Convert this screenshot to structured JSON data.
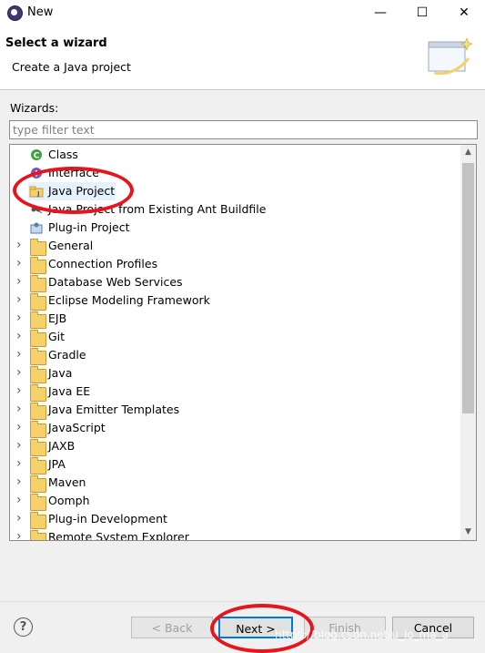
{
  "window": {
    "title": "New",
    "minimize": "—",
    "maximize": "☐",
    "close": "✕"
  },
  "header": {
    "title": "Select a wizard",
    "description": "Create a Java project"
  },
  "wizards_label": "Wizards:",
  "filter": {
    "placeholder": "type filter text",
    "value": ""
  },
  "tree_items": [
    {
      "label": "Class",
      "icon": "class-icon",
      "expandable": false
    },
    {
      "label": "Interface",
      "icon": "interface-icon",
      "expandable": false
    },
    {
      "label": "Java Project",
      "icon": "java-project-icon",
      "expandable": false,
      "selected": true
    },
    {
      "label": "Java Project from Existing Ant Buildfile",
      "icon": "ant-project-icon",
      "expandable": false
    },
    {
      "label": "Plug-in Project",
      "icon": "plugin-project-icon",
      "expandable": false
    },
    {
      "label": "General",
      "icon": "folder-icon",
      "expandable": true
    },
    {
      "label": "Connection Profiles",
      "icon": "folder-icon",
      "expandable": true
    },
    {
      "label": "Database Web Services",
      "icon": "folder-icon",
      "expandable": true
    },
    {
      "label": "Eclipse Modeling Framework",
      "icon": "folder-icon",
      "expandable": true
    },
    {
      "label": "EJB",
      "icon": "folder-icon",
      "expandable": true
    },
    {
      "label": "Git",
      "icon": "folder-icon",
      "expandable": true
    },
    {
      "label": "Gradle",
      "icon": "folder-icon",
      "expandable": true
    },
    {
      "label": "Java",
      "icon": "folder-icon",
      "expandable": true
    },
    {
      "label": "Java EE",
      "icon": "folder-icon",
      "expandable": true
    },
    {
      "label": "Java Emitter Templates",
      "icon": "folder-icon",
      "expandable": true
    },
    {
      "label": "JavaScript",
      "icon": "folder-icon",
      "expandable": true
    },
    {
      "label": "JAXB",
      "icon": "folder-icon",
      "expandable": true
    },
    {
      "label": "JPA",
      "icon": "folder-icon",
      "expandable": true
    },
    {
      "label": "Maven",
      "icon": "folder-icon",
      "expandable": true
    },
    {
      "label": "Oomph",
      "icon": "folder-icon",
      "expandable": true
    },
    {
      "label": "Plug-in Development",
      "icon": "folder-icon",
      "expandable": true
    },
    {
      "label": "Remote System Explorer",
      "icon": "folder-icon",
      "expandable": true
    }
  ],
  "buttons": {
    "back": "< Back",
    "next": "Next >",
    "finish": "Finish",
    "cancel": "Cancel",
    "help": "?"
  },
  "watermark": "https://blog.csdn.net/u_lo_ma_a",
  "colors": {
    "annotation_red": "#e8141c",
    "selection": "#e5f1fb",
    "default_button_border": "#0078d7"
  }
}
